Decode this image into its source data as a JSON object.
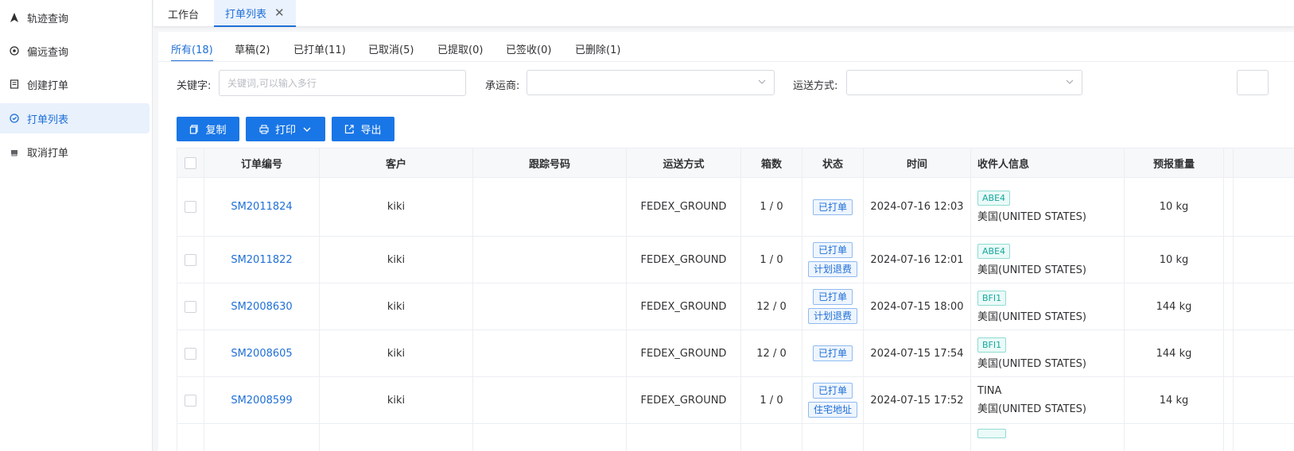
{
  "sidebar": {
    "items": [
      {
        "label": "轨迹查询",
        "icon": "navigation-icon"
      },
      {
        "label": "偏远查询",
        "icon": "target-icon"
      },
      {
        "label": "创建打单",
        "icon": "document-icon"
      },
      {
        "label": "打单列表",
        "icon": "list-icon"
      },
      {
        "label": "取消打单",
        "icon": "printer-icon"
      }
    ],
    "active_index": 3
  },
  "page_tabs": [
    {
      "label": "工作台"
    },
    {
      "label": "打单列表",
      "closable": true
    }
  ],
  "status_tabs": [
    {
      "label": "所有(18)"
    },
    {
      "label": "草稿(2)"
    },
    {
      "label": "已打单(11)"
    },
    {
      "label": "已取消(5)"
    },
    {
      "label": "已提取(0)"
    },
    {
      "label": "已签收(0)"
    },
    {
      "label": "已删除(1)"
    }
  ],
  "filters": {
    "keyword_label": "关键字:",
    "keyword_placeholder": "关键词,可以输入多行",
    "carrier_label": "承运商:",
    "shipping_label": "运送方式:"
  },
  "toolbar": {
    "copy_label": "复制",
    "print_label": "打印",
    "export_label": "导出"
  },
  "table": {
    "headers": {
      "order_no": "订单编号",
      "customer": "客户",
      "tracking": "跟踪号码",
      "shipping": "运送方式",
      "boxes": "箱数",
      "status": "状态",
      "time": "时间",
      "recipient": "收件人信息",
      "weight": "预报重量"
    },
    "rows": [
      {
        "order_no": "SM2011824",
        "customer": "kiki",
        "tracking": "",
        "shipping": "FEDEX_GROUND",
        "boxes": "1 / 0",
        "status": [
          "已打单"
        ],
        "time": "2024-07-16 12:03",
        "warehouse": "ABE4",
        "recipient_name": "",
        "country": "美国(UNITED STATES)",
        "weight": "10 kg"
      },
      {
        "order_no": "SM2011822",
        "customer": "kiki",
        "tracking": "",
        "shipping": "FEDEX_GROUND",
        "boxes": "1 / 0",
        "status": [
          "已打单",
          "计划退费"
        ],
        "time": "2024-07-16 12:01",
        "warehouse": "ABE4",
        "recipient_name": "",
        "country": "美国(UNITED STATES)",
        "weight": "10 kg"
      },
      {
        "order_no": "SM2008630",
        "customer": "kiki",
        "tracking": "",
        "shipping": "FEDEX_GROUND",
        "boxes": "12 / 0",
        "status": [
          "已打单",
          "计划退费"
        ],
        "time": "2024-07-15 18:00",
        "warehouse": "BFI1",
        "recipient_name": "",
        "country": "美国(UNITED STATES)",
        "weight": "144 kg"
      },
      {
        "order_no": "SM2008605",
        "customer": "kiki",
        "tracking": "",
        "shipping": "FEDEX_GROUND",
        "boxes": "12 / 0",
        "status": [
          "已打单"
        ],
        "time": "2024-07-15 17:54",
        "warehouse": "BFI1",
        "recipient_name": "",
        "country": "美国(UNITED STATES)",
        "weight": "144 kg"
      },
      {
        "order_no": "SM2008599",
        "customer": "kiki",
        "tracking": "",
        "shipping": "FEDEX_GROUND",
        "boxes": "1 / 0",
        "status": [
          "已打单",
          "住宅地址"
        ],
        "time": "2024-07-15 17:52",
        "warehouse": "",
        "recipient_name": "TINA",
        "country": "美国(UNITED STATES)",
        "weight": "14 kg"
      }
    ]
  },
  "colors": {
    "primary": "#1976e6",
    "link": "#1f6fd6",
    "warehouse_tag": "#17a79a"
  }
}
